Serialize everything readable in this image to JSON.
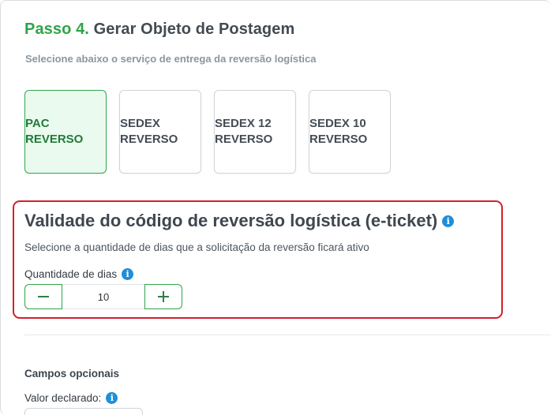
{
  "step": {
    "number_label": "Passo 4.",
    "title": "Gerar Objeto de Postagem",
    "subtitle": "Selecione abaixo o serviço de entrega da reversão logística"
  },
  "services": [
    {
      "label": "PAC\nREVERSO",
      "selected": true
    },
    {
      "label": "SEDEX\nREVERSO",
      "selected": false
    },
    {
      "label": "SEDEX 12\nREVERSO",
      "selected": false
    },
    {
      "label": "SEDEX 10\nREVERSO",
      "selected": false
    }
  ],
  "validity": {
    "title": "Validade do código de reversão logística (e-ticket)",
    "description": "Selecione a quantidade de dias que a solicitação da reversão ficará ativo",
    "quantity_label": "Quantidade de dias",
    "quantity_value": "10"
  },
  "optional": {
    "title": "Campos opcionais",
    "declared_value_label": "Valor declarado:",
    "declared_value": ""
  },
  "icons": {
    "info": "info-icon",
    "minus": "minus-icon",
    "plus": "plus-icon"
  },
  "colors": {
    "accent_green": "#2ea449",
    "selected_bg": "#eafaee",
    "highlight_red": "#d41f2a",
    "info_blue": "#1f8fd8"
  }
}
